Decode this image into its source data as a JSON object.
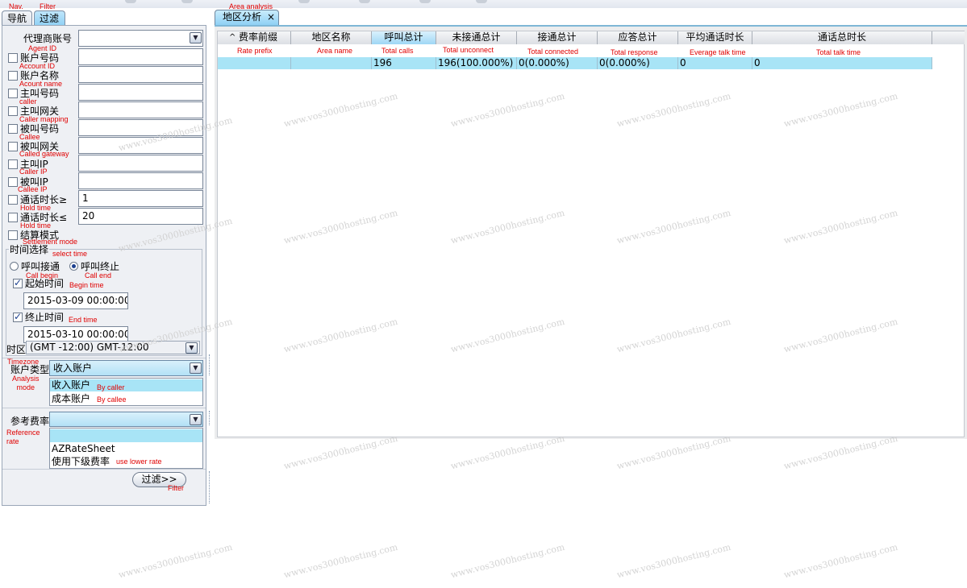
{
  "annotations": {
    "nav": "Nav.",
    "filter": "Filter",
    "area_analysis": "Area analysis",
    "agent_id": "Agent ID",
    "account_id": "Account ID",
    "account_name": "Acount name",
    "caller": "caller",
    "caller_mapping": "Caller mapping",
    "callee": "Callee",
    "called_gateway": "Called gateway",
    "caller_ip": "Caller IP",
    "callee_ip": "Callee IP",
    "hold_time_1": "Hold time",
    "hold_time_2": "Hold time",
    "settlement_mode": "Settlement mode",
    "select_time": "select time",
    "call_begin": "Call begin",
    "call_end": "Call end",
    "begin_time": "Begin time",
    "end_time": "End time",
    "timezone": "Timezone",
    "analysis_mode": "Analysis\nmode",
    "by_caller": "By caller",
    "by_callee": "By callee",
    "reference_rate": "Reference\nrate",
    "use_lower_rate": "use lower rate",
    "filter_btn": "Filter",
    "rate_prefix": "Rate prefix",
    "area_name": "Area name",
    "total_calls": "Total calls",
    "total_unconnect": "Total unconnect",
    "total_connected": "Total connected",
    "total_response": "Total response",
    "average_talk_time": "Everage talk time",
    "total_talk_time": "Total talk time"
  },
  "watermark": "www.vos3000hosting.com",
  "left_tabs": {
    "nav": "导航",
    "filter": "过滤"
  },
  "filter_form": {
    "agent_account_label": "代理商账号",
    "agent_account_value": "",
    "fields": [
      {
        "label": "账户号码",
        "value": "",
        "checked": false
      },
      {
        "label": "账户名称",
        "value": "",
        "checked": false
      },
      {
        "label": "主叫号码",
        "value": "",
        "checked": false
      },
      {
        "label": "主叫网关",
        "value": "",
        "checked": false
      },
      {
        "label": "被叫号码",
        "value": "",
        "checked": false
      },
      {
        "label": "被叫网关",
        "value": "",
        "checked": false
      },
      {
        "label": "主叫IP",
        "value": "",
        "checked": false
      },
      {
        "label": "被叫IP",
        "value": "",
        "checked": false
      },
      {
        "label": "通话时长≥",
        "value": "1",
        "checked": false
      },
      {
        "label": "通话时长≤",
        "value": "20",
        "checked": false
      }
    ],
    "settlement_mode_label": "结算模式",
    "time_group_label": "时间选择",
    "radio_call_begin": "呼叫接通",
    "radio_call_end": "呼叫终止",
    "radio_selected": "call_end",
    "begin_time_label": "起始时间",
    "begin_time_checked": true,
    "begin_time_value": "2015-03-09 00:00:00",
    "end_time_label": "终止时间",
    "end_time_checked": true,
    "end_time_value": "2015-03-10 00:00:00",
    "timezone_label": "时区",
    "timezone_value": "(GMT -12:00) GMT-12:00",
    "account_type_label": "账户类型",
    "account_type_value": "收入账户",
    "account_type_options": [
      "收入账户",
      "成本账户"
    ],
    "reference_rate_label": "参考费率",
    "reference_rate_value": "",
    "reference_rate_options": [
      "",
      "AZRateSheet",
      "使用下级费率"
    ],
    "filter_button": "过滤>>"
  },
  "right_tab": {
    "label": "地区分析",
    "close": "×"
  },
  "table": {
    "sort_arrow": "^",
    "columns": [
      "费率前缀",
      "地区名称",
      "呼叫总计",
      "未接通总计",
      "接通总计",
      "应答总计",
      "平均通话时长",
      "通话总时长"
    ],
    "rows": [
      [
        "",
        "",
        "196",
        "196(100.000%)",
        "0(0.000%)",
        "0(0.000%)",
        "0",
        "0"
      ]
    ]
  }
}
